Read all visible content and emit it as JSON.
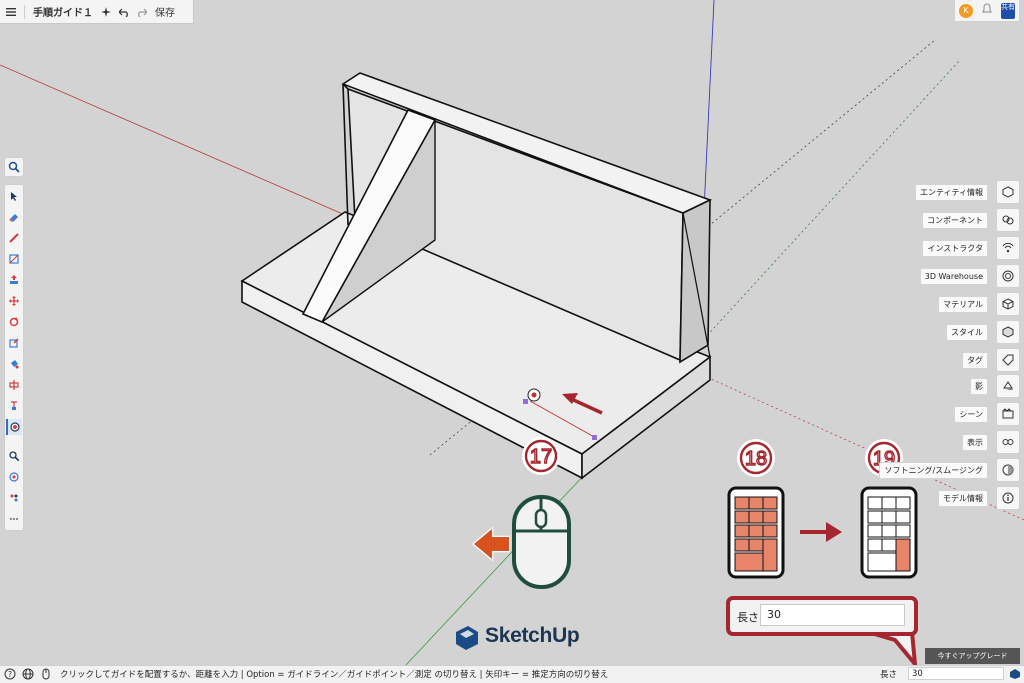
{
  "app": {
    "document_title": "手順ガイド１",
    "save_label": "保存",
    "avatar_initial": "K",
    "share_label": "共有"
  },
  "right_panel": {
    "items": [
      {
        "label": "エンティティ情報",
        "icon": "entity-info-icon"
      },
      {
        "label": "コンポーネント",
        "icon": "components-icon"
      },
      {
        "label": "インストラクタ",
        "icon": "instructor-icon"
      },
      {
        "label": "3D Warehouse",
        "icon": "warehouse-icon"
      },
      {
        "label": "マテリアル",
        "icon": "materials-icon"
      },
      {
        "label": "スタイル",
        "icon": "styles-icon"
      },
      {
        "label": "タグ",
        "icon": "tags-icon"
      },
      {
        "label": "影",
        "icon": "shadows-icon"
      },
      {
        "label": "シーン",
        "icon": "scenes-icon"
      },
      {
        "label": "表示",
        "icon": "display-icon"
      },
      {
        "label": "ソフトニング/スムージング",
        "icon": "soften-icon"
      },
      {
        "label": "モデル情報",
        "icon": "model-info-icon"
      }
    ]
  },
  "upgrade_label": "今すぐアップグレード",
  "status_bar": {
    "message": "クリックしてガイドを配置するか、距離を入力 | Option = ガイドライン／ガイドポイント／測定 の切り替え | 矢印キー = 推定方向の切り替え",
    "length_label": "長さ",
    "length_value": "30"
  },
  "annotations": {
    "step17": "17",
    "step18": "18",
    "step19": "19",
    "callout_label": "長さ",
    "callout_value": "30"
  },
  "logo_text": "SketchUp",
  "colors": {
    "annotation_red": "#a5262e",
    "mouse_green": "#1f4d3f",
    "arrow_orange": "#d8521e",
    "keypad_fill": "#e8846a"
  }
}
